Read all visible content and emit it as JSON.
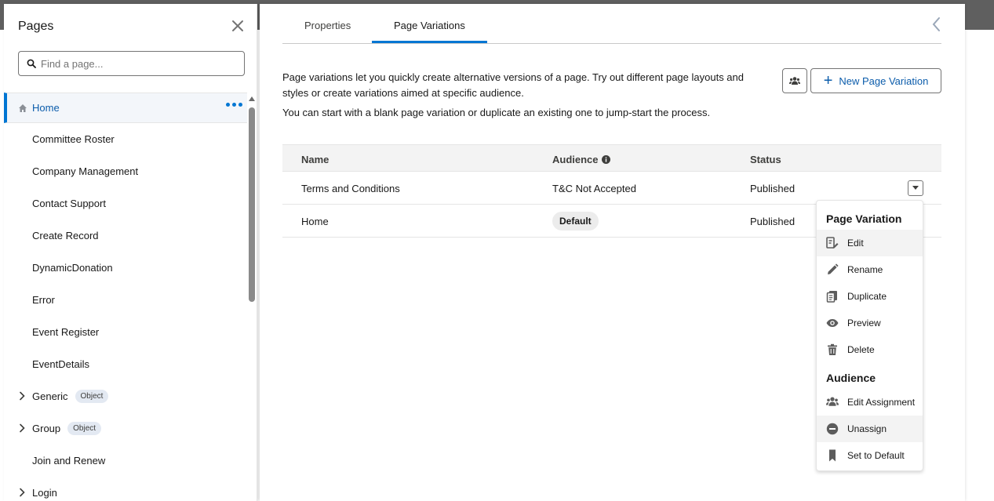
{
  "pages_panel": {
    "title": "Pages",
    "search_placeholder": "Find a page...",
    "items": [
      {
        "label": "Home",
        "active": true
      },
      {
        "label": "Committee Roster"
      },
      {
        "label": "Company Management"
      },
      {
        "label": "Contact Support"
      },
      {
        "label": "Create Record"
      },
      {
        "label": "DynamicDonation"
      },
      {
        "label": "Error"
      },
      {
        "label": "Event Register"
      },
      {
        "label": "EventDetails"
      },
      {
        "label": "Generic",
        "badge": "Object",
        "expandable": true
      },
      {
        "label": "Group",
        "badge": "Object",
        "expandable": true
      },
      {
        "label": "Join and Renew"
      },
      {
        "label": "Login",
        "expandable": true
      }
    ]
  },
  "main": {
    "tabs": [
      {
        "label": "Properties"
      },
      {
        "label": "Page Variations",
        "active": true
      }
    ],
    "description_1": "Page variations let you quickly create alternative versions of a page. Try out different page layouts and styles or create variations aimed at specific audience.",
    "description_2": "You can start with a blank page variation or duplicate an existing one to jump-start the process.",
    "new_button_label": "New Page Variation",
    "table": {
      "headers": {
        "name": "Name",
        "audience": "Audience",
        "status": "Status"
      },
      "rows": [
        {
          "name": "Terms and Conditions",
          "audience": "T&C Not Accepted",
          "status": "Published"
        },
        {
          "name": "Home",
          "audience_badge": "Default",
          "status": "Published"
        }
      ]
    }
  },
  "menu": {
    "section1_title": "Page Variation",
    "section1_items": [
      "Edit",
      "Rename",
      "Duplicate",
      "Preview",
      "Delete"
    ],
    "section2_title": "Audience",
    "section2_items": [
      "Edit Assignment",
      "Unassign",
      "Set to Default"
    ]
  },
  "colors": {
    "accent": "#0176d3",
    "accent_text": "#0b5cab",
    "text": "#181818",
    "muted": "#747474",
    "badge_bg": "#e3e9f2"
  }
}
